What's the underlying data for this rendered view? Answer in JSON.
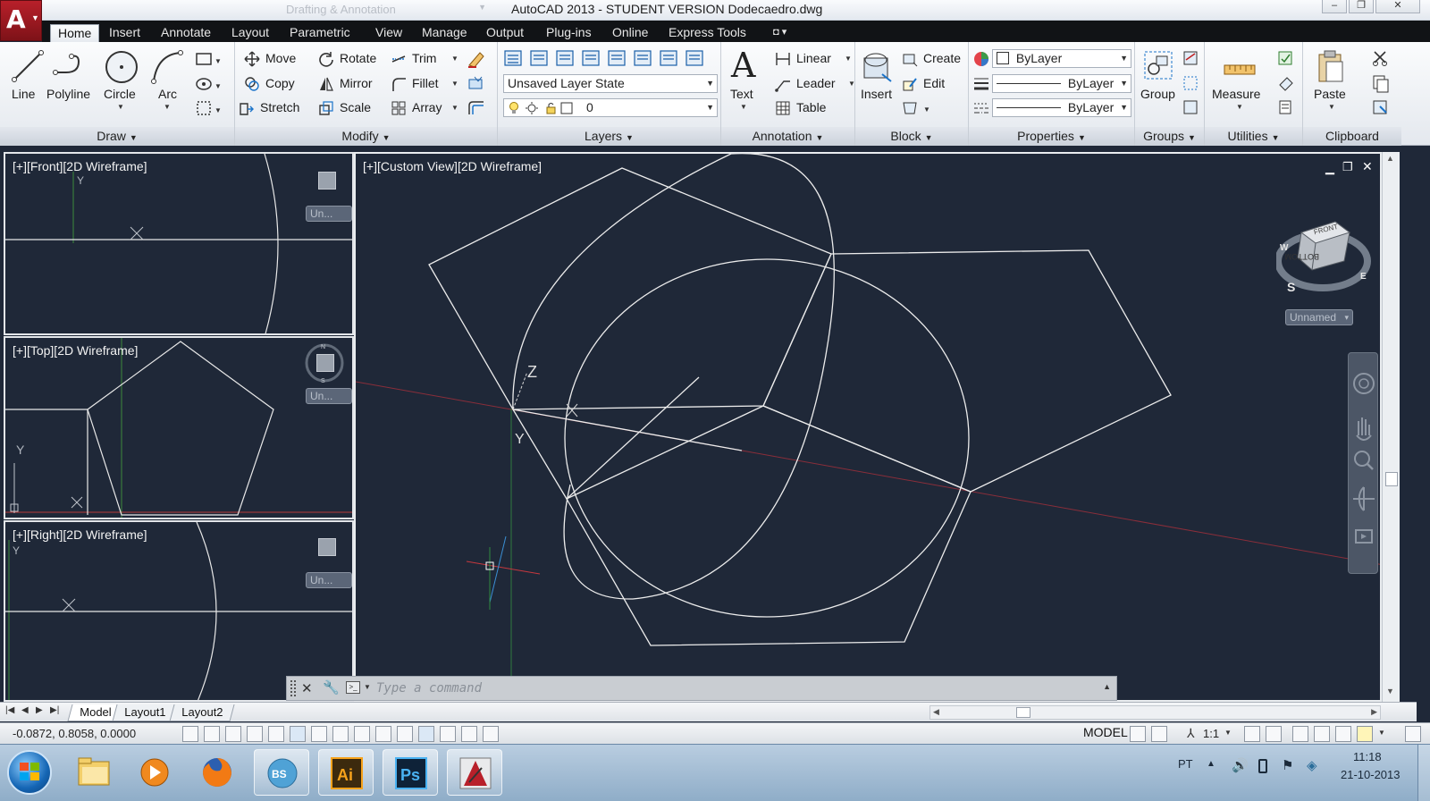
{
  "titlebar": {
    "workspace": "Drafting & Annotation",
    "title": "AutoCAD 2013 - STUDENT VERSION    Dodecaedro.dwg",
    "minimize": "–",
    "restore": "❐",
    "close": "✕"
  },
  "menu_tabs": [
    "Home",
    "Insert",
    "Annotate",
    "Layout",
    "Parametric",
    "View",
    "Manage",
    "Output",
    "Plug-ins",
    "Online",
    "Express Tools"
  ],
  "ribbon": {
    "draw": {
      "title": "Draw",
      "line": "Line",
      "polyline": "Polyline",
      "circle": "Circle",
      "arc": "Arc"
    },
    "modify": {
      "title": "Modify",
      "move": "Move",
      "rotate": "Rotate",
      "trim": "Trim",
      "copy": "Copy",
      "mirror": "Mirror",
      "fillet": "Fillet",
      "stretch": "Stretch",
      "scale": "Scale",
      "array": "Array"
    },
    "layers": {
      "title": "Layers",
      "layer_state": "Unsaved Layer State",
      "current_layer": "0"
    },
    "annotation": {
      "title": "Annotation",
      "text": "Text",
      "linear": "Linear",
      "leader": "Leader",
      "table": "Table"
    },
    "block": {
      "title": "Block",
      "insert": "Insert",
      "create": "Create",
      "edit": "Edit"
    },
    "properties": {
      "title": "Properties",
      "color": "ByLayer",
      "linetype": "ByLayer",
      "lineweight": "ByLayer"
    },
    "groups": {
      "title": "Groups",
      "group": "Group"
    },
    "utilities": {
      "title": "Utilities",
      "measure": "Measure"
    },
    "clipboard": {
      "title": "Clipboard",
      "paste": "Paste"
    }
  },
  "viewports": {
    "front": {
      "label": "[+][Front][2D Wireframe]",
      "un": "Un..."
    },
    "top": {
      "label": "[+][Top][2D Wireframe]",
      "un": "Un..."
    },
    "right": {
      "label": "[+][Right][2D Wireframe]",
      "un": "Un..."
    },
    "custom": {
      "label": "[+][Custom View][2D Wireframe]",
      "unnamed": "Unnamed"
    }
  },
  "viewcube": {
    "front": "FRONT",
    "bottom": "BOTTOM",
    "w": "W",
    "e": "E",
    "s": "S"
  },
  "axes": {
    "z": "Z",
    "y": "Y"
  },
  "command_line": {
    "placeholder": "Type  a  command"
  },
  "layout_tabs": [
    "Model",
    "Layout1",
    "Layout2"
  ],
  "status": {
    "coords": "-0.0872, 0.8058, 0.0000",
    "model": "MODEL",
    "scale": "1:1"
  },
  "taskbar": {
    "lang": "PT",
    "time": "11:18",
    "date": "21-10-2013"
  },
  "colors": {
    "canvas": "#1f2838",
    "ribbon": "#e9edf2",
    "accent": "#b8202a"
  }
}
